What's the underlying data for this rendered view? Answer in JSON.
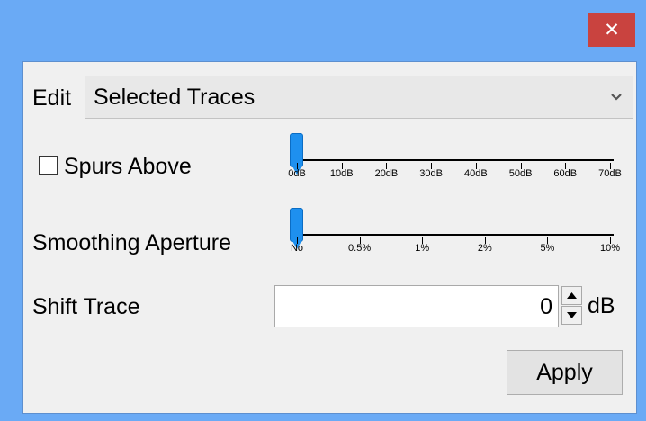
{
  "titlebar": {
    "close_glyph": "✕"
  },
  "edit": {
    "label": "Edit",
    "selected": "Selected Traces"
  },
  "spurs": {
    "label": "Spurs Above",
    "checked": false,
    "value": "0dB",
    "ticks": [
      "0dB",
      "10dB",
      "20dB",
      "30dB",
      "40dB",
      "50dB",
      "60dB",
      "70dB"
    ]
  },
  "smoothing": {
    "label": "Smoothing Aperture",
    "value": "No",
    "ticks": [
      "No",
      "0.5%",
      "1%",
      "2%",
      "5%",
      "10%"
    ]
  },
  "shift": {
    "label": "Shift Trace",
    "value": "0",
    "unit": "dB"
  },
  "apply_label": "Apply",
  "colors": {
    "titlebar": "#6aaaf5",
    "close": "#c9433f",
    "slider_thumb": "#1e90ef"
  }
}
